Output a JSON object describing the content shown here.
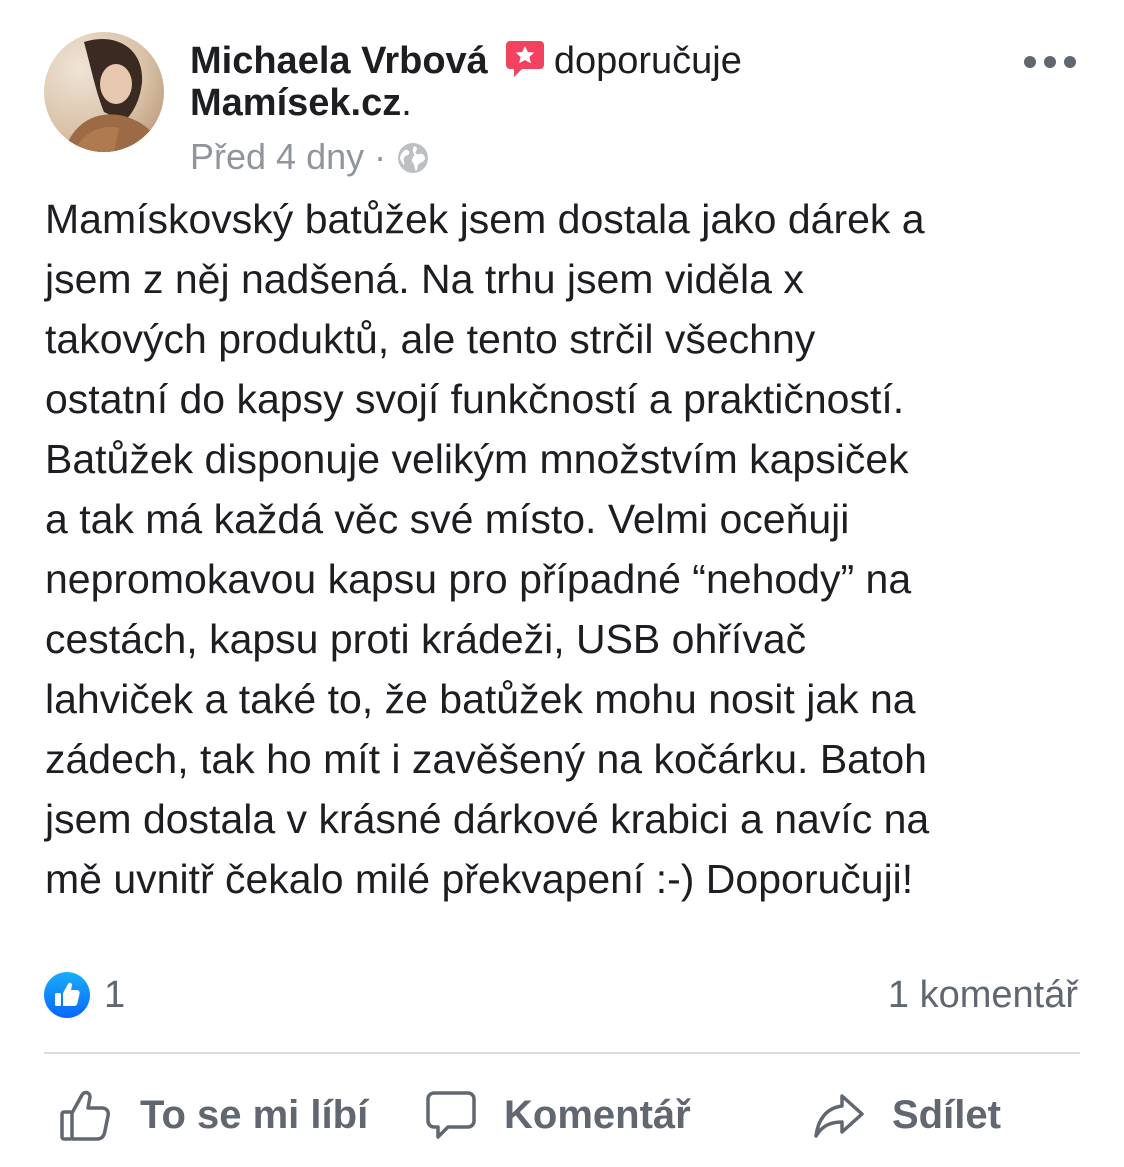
{
  "post": {
    "author": "Michaela Vrbová",
    "action_text": "doporučuje",
    "page_name": "Mamísek.cz",
    "page_suffix": ".",
    "timestamp": "Před 4 dny",
    "separator": "·",
    "privacy_icon": "globe-icon",
    "recommend_icon": "recommendation-star-icon",
    "more_icon": "more-options-icon",
    "body": "Mamískovský batůžek jsem dostala jako dárek a\njsem z něj nadšená. Na trhu jsem viděla x\ntakových produktů, ale tento strčil všechny\nostatní do kapsy svojí funkčností a praktičností.\nBatůžek disponuje velikým množstvím kapsiček\na tak má každá věc své místo. Velmi oceňuji\nnepromokavou kapsu pro případné “nehody” na\ncestách, kapsu proti krádeži, USB ohřívač\nlahviček a také to, že batůžek mohu nosit jak na\nzádech, tak ho mít i zavěšený na kočárku. Batoh\njsem dostala v krásné dárkové krabici a navíc na\nmě uvnitř čekalo milé překvapení :-) Doporučuji!"
  },
  "stats": {
    "likes": "1",
    "comments": "1 komentář"
  },
  "actions": {
    "like_label": "To se mi líbí",
    "comment_label": "Komentář",
    "share_label": "Sdílet"
  },
  "colors": {
    "recommend_red": "#f3425f",
    "like_blue": "#1877f2",
    "secondary_text": "#606770",
    "meta_text": "#90949c"
  }
}
